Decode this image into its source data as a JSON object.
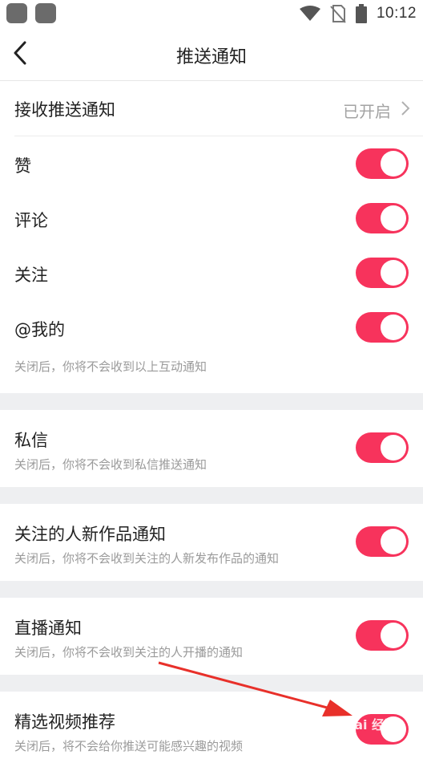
{
  "status_bar": {
    "time": "10:12",
    "icons": [
      "wifi-icon",
      "no-sim-icon",
      "battery-icon"
    ]
  },
  "header": {
    "title": "推送通知",
    "back_icon": "chevron-left-icon"
  },
  "receive_push": {
    "label": "接收推送通知",
    "value": "已开启"
  },
  "interaction": {
    "items": [
      {
        "label": "赞",
        "on": true
      },
      {
        "label": "评论",
        "on": true
      },
      {
        "label": "关注",
        "on": true
      },
      {
        "label": "@我的",
        "on": true
      }
    ],
    "note": "关闭后，你将不会收到以上互动通知"
  },
  "private_msg": {
    "label": "私信",
    "sub": "关闭后，你将不会收到私信推送通知",
    "on": true
  },
  "new_works": {
    "label": "关注的人新作品通知",
    "sub": "关闭后，你将不会收到关注的人新发布作品的通知",
    "on": true
  },
  "live": {
    "label": "直播通知",
    "sub": "关闭后，你将不会收到关注的人开播的通知",
    "on": true
  },
  "featured": {
    "label": "精选视频推荐",
    "sub": "关闭后，将不会给你推送可能感兴趣的视频",
    "on": true
  },
  "colors": {
    "accent": "#f7335c",
    "divider_bg": "#eeeff1",
    "annotation_arrow": "#e8302a"
  },
  "watermark": "Bai 经验"
}
